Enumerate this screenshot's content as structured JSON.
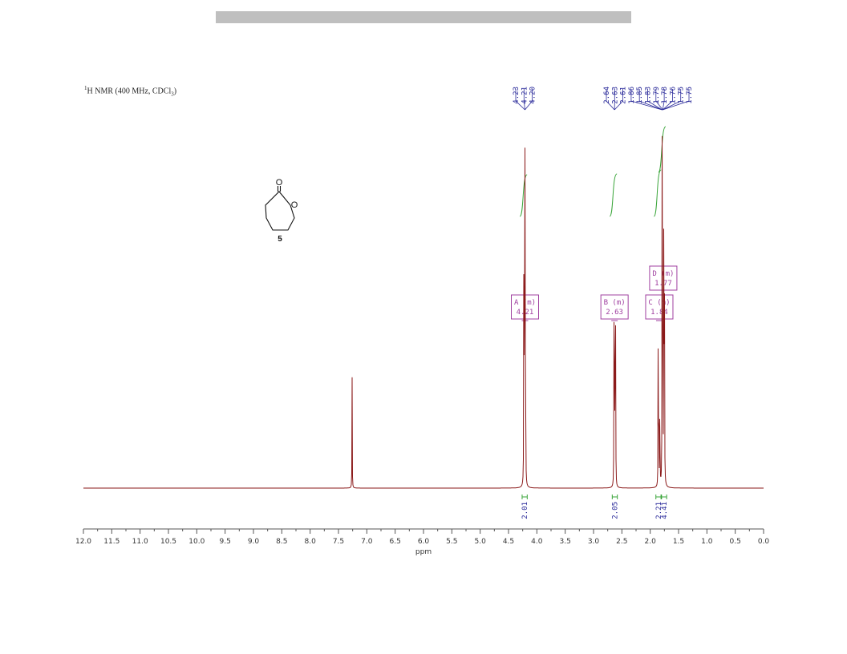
{
  "header": {
    "redaction_color": "#bfbfbf"
  },
  "spectrum_title": {
    "superscript": "1",
    "main": "H NMR (400 MHz, CDCl",
    "subscript": "3",
    "close": ")"
  },
  "structure": {
    "carbonyl_oxygen_label": "O",
    "ring_oxygen_label": "O",
    "compound_number": "5"
  },
  "chart_data": {
    "type": "line",
    "xlabel": "ppm",
    "xlim": [
      12.0,
      0.0
    ],
    "x_reversed": true,
    "x_ticks": [
      "12.0",
      "11.5",
      "11.0",
      "10.5",
      "10.0",
      "9.5",
      "9.0",
      "8.5",
      "8.0",
      "7.5",
      "7.0",
      "6.5",
      "6.0",
      "5.5",
      "5.0",
      "4.5",
      "4.0",
      "3.5",
      "3.0",
      "2.5",
      "2.0",
      "1.5",
      "1.0",
      "0.5",
      "0.0"
    ],
    "x_tick_values": [
      12.0,
      11.5,
      11.0,
      10.5,
      10.0,
      9.5,
      9.0,
      8.5,
      8.0,
      7.5,
      7.0,
      6.5,
      6.0,
      5.5,
      5.0,
      4.5,
      4.0,
      3.5,
      3.0,
      2.5,
      2.0,
      1.5,
      1.0,
      0.5,
      0.0
    ],
    "spectrum_color": "#8b1a1a",
    "integral_color": "#3aa53a",
    "label_color": "#2a2a9a",
    "multiplet_color": "#a040a0",
    "peaks": [
      {
        "ppm": 7.26,
        "height": 0.32
      },
      {
        "ppm": 4.23,
        "height": 0.64
      },
      {
        "ppm": 4.22,
        "height": 0.86
      },
      {
        "ppm": 4.21,
        "height": 0.84
      },
      {
        "ppm": 4.2,
        "height": 0.62
      },
      {
        "ppm": 2.64,
        "height": 0.46
      },
      {
        "ppm": 2.63,
        "height": 0.47
      },
      {
        "ppm": 2.62,
        "height": 0.47
      },
      {
        "ppm": 2.61,
        "height": 0.45
      },
      {
        "ppm": 1.86,
        "height": 0.4
      },
      {
        "ppm": 1.85,
        "height": 0.39
      },
      {
        "ppm": 1.83,
        "height": 0.35
      },
      {
        "ppm": 1.79,
        "height": 0.9
      },
      {
        "ppm": 1.78,
        "height": 0.97
      },
      {
        "ppm": 1.76,
        "height": 0.98
      },
      {
        "ppm": 1.75,
        "height": 0.92
      }
    ],
    "peak_labels": [
      {
        "group": "left",
        "labels": [
          "4.23",
          "4.21",
          "4.20"
        ],
        "converge_ppm": 4.21
      },
      {
        "group": "right",
        "labels": [
          "2.64",
          "2.63",
          "2.61",
          "1.86",
          "1.85",
          "1.83",
          "1.79",
          "1.78",
          "1.76",
          "1.75",
          "1.75"
        ],
        "converge_ppm": [
          2.63,
          2.63,
          2.63,
          1.79,
          1.79,
          1.79,
          1.78,
          1.78,
          1.78,
          1.78,
          1.78
        ]
      }
    ],
    "multiplets": [
      {
        "id": "A",
        "line1": "A (m)",
        "line2": "4.21",
        "ppm": 4.21,
        "level": "low"
      },
      {
        "id": "B",
        "line1": "B (m)",
        "line2": "2.63",
        "ppm": 2.63,
        "level": "low"
      },
      {
        "id": "C",
        "line1": "C (m)",
        "line2": "1.84",
        "ppm": 1.84,
        "level": "low"
      },
      {
        "id": "D",
        "line1": "D (m)",
        "line2": "1.77",
        "ppm": 1.77,
        "level": "high"
      }
    ],
    "integrals": [
      {
        "ppm_from": 4.26,
        "ppm_to": 4.17,
        "value": "2.01"
      },
      {
        "ppm_from": 2.67,
        "ppm_to": 2.58,
        "value": "2.05"
      },
      {
        "ppm_from": 1.9,
        "ppm_to": 1.81,
        "value": "2.21"
      },
      {
        "ppm_from": 1.8,
        "ppm_to": 1.71,
        "value": "4.41"
      }
    ]
  }
}
